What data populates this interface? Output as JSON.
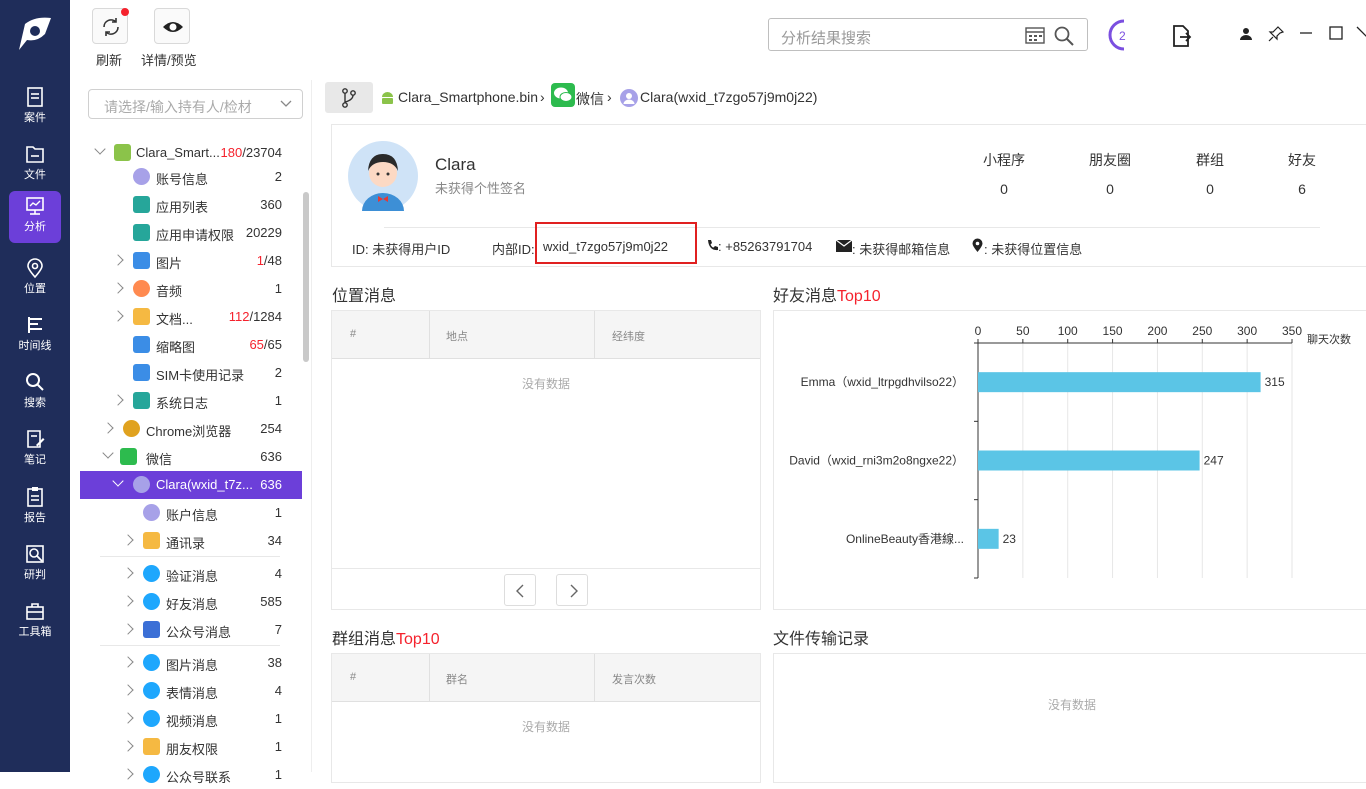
{
  "nav": {
    "items": [
      {
        "label": "案件",
        "icon": "case-icon"
      },
      {
        "label": "文件",
        "icon": "folder-icon"
      },
      {
        "label": "分析",
        "icon": "analysis-icon",
        "active": true
      },
      {
        "label": "位置",
        "icon": "location-icon"
      },
      {
        "label": "时间线",
        "icon": "timeline-icon"
      },
      {
        "label": "搜索",
        "icon": "search-icon"
      },
      {
        "label": "笔记",
        "icon": "notes-icon"
      },
      {
        "label": "报告",
        "icon": "report-icon"
      },
      {
        "label": "研判",
        "icon": "judge-icon"
      },
      {
        "label": "工具箱",
        "icon": "toolbox-icon"
      }
    ]
  },
  "toolbar": {
    "refresh_label": "刷新",
    "preview_label": "详情/预览",
    "search_placeholder": "分析结果搜索",
    "task_count": "2"
  },
  "tree": {
    "select_placeholder": "请选择/输入持有人/检材",
    "rows": [
      {
        "label": "Clara_Smart...",
        "count_red": "180",
        "count": "/23704"
      },
      {
        "label": "账号信息",
        "count": "2"
      },
      {
        "label": "应用列表",
        "count": "360"
      },
      {
        "label": "应用申请权限",
        "count": "20229"
      },
      {
        "label": "图片",
        "count_red": "1",
        "count": "/48"
      },
      {
        "label": "音频",
        "count": "1"
      },
      {
        "label": "文档...",
        "count_red": "112",
        "count": "/1284"
      },
      {
        "label": "缩略图",
        "count_red": "65",
        "count": "/65"
      },
      {
        "label": "SIM卡使用记录",
        "count": "2"
      },
      {
        "label": "系统日志",
        "count": "1"
      },
      {
        "label": "Chrome浏览器",
        "count": "254"
      },
      {
        "label": "微信",
        "count": "636"
      },
      {
        "label": "Clara(wxid_t7z...",
        "count": "636"
      },
      {
        "label": "账户信息",
        "count": "1"
      },
      {
        "label": "通讯录",
        "count": "34"
      },
      {
        "label": "验证消息",
        "count": "4"
      },
      {
        "label": "好友消息",
        "count": "585"
      },
      {
        "label": "公众号消息",
        "count": "7"
      },
      {
        "label": "图片消息",
        "count": "38"
      },
      {
        "label": "表情消息",
        "count": "4"
      },
      {
        "label": "视频消息",
        "count": "1"
      },
      {
        "label": "朋友权限",
        "count": "1"
      },
      {
        "label": "公众号联系",
        "count": "1"
      }
    ]
  },
  "breadcrumb": {
    "device": "Clara_Smartphone.bin",
    "app": "微信",
    "account": "Clara(wxid_t7zgo57j9m0j22)"
  },
  "profile": {
    "name": "Clara",
    "signature": "未获得个性签名",
    "stats": [
      {
        "label": "小程序",
        "value": "0"
      },
      {
        "label": "朋友圈",
        "value": "0"
      },
      {
        "label": "群组",
        "value": "0"
      },
      {
        "label": "好友",
        "value": "6"
      }
    ],
    "id_text": "ID: 未获得用户ID",
    "inner_id_label": "内部ID:",
    "inner_id": "wxid_t7zgo57j9m0j22",
    "phone": ": +85263791704",
    "email": ": 未获得邮箱信息",
    "location": ": 未获得位置信息"
  },
  "location_section": {
    "title": "位置消息",
    "cols": [
      "#",
      "地点",
      "经纬度"
    ],
    "empty": "没有数据"
  },
  "friend_section": {
    "title": "好友消息",
    "title_hl": "Top10"
  },
  "group_section": {
    "title": "群组消息",
    "title_hl": "Top10",
    "cols": [
      "#",
      "群名",
      "发言次数"
    ],
    "empty": "没有数据"
  },
  "file_section": {
    "title": "文件传输记录",
    "empty": "没有数据"
  },
  "chart_data": {
    "type": "bar",
    "orientation": "horizontal",
    "categories": [
      "Emma（wxid_ltrpgdhvilso22）",
      "David（wxid_rni3m2o8ngxe22）",
      "OnlineBeauty香港線..."
    ],
    "values": [
      315,
      247,
      23
    ],
    "xlabel": "聊天次数",
    "xlim": [
      0,
      350
    ],
    "ticks": [
      0,
      50,
      100,
      150,
      200,
      250,
      300,
      350
    ],
    "color": "#5bc5e6",
    "grid": true
  }
}
